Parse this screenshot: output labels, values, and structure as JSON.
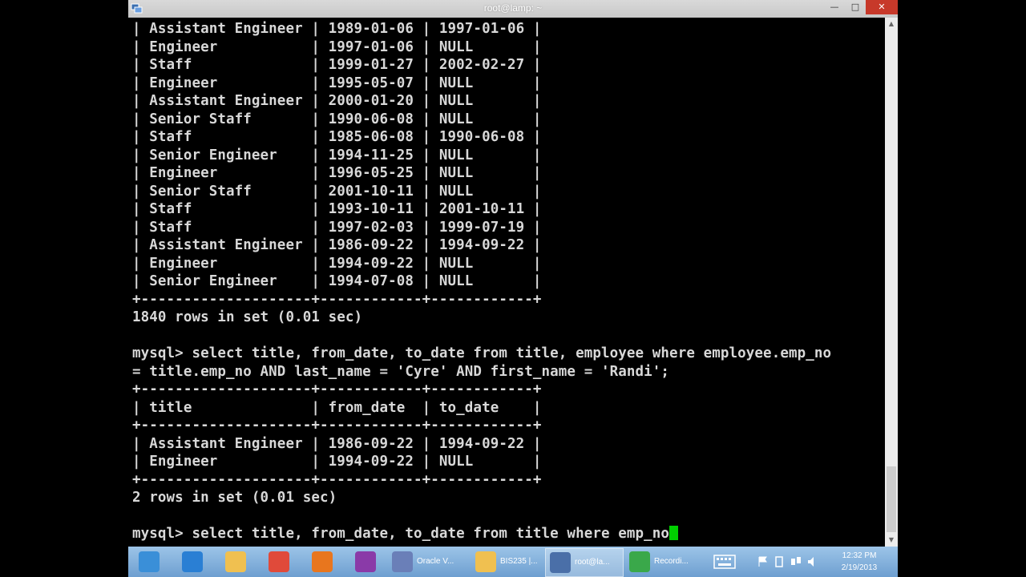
{
  "window": {
    "title": "root@lamp: ~"
  },
  "terminal": {
    "lines": [
      "| Assistant Engineer | 1989-01-06 | 1997-01-06 |",
      "| Engineer           | 1997-01-06 | NULL       |",
      "| Staff              | 1999-01-27 | 2002-02-27 |",
      "| Engineer           | 1995-05-07 | NULL       |",
      "| Assistant Engineer | 2000-01-20 | NULL       |",
      "| Senior Staff       | 1990-06-08 | NULL       |",
      "| Staff              | 1985-06-08 | 1990-06-08 |",
      "| Senior Engineer    | 1994-11-25 | NULL       |",
      "| Engineer           | 1996-05-25 | NULL       |",
      "| Senior Staff       | 2001-10-11 | NULL       |",
      "| Staff              | 1993-10-11 | 2001-10-11 |",
      "| Staff              | 1997-02-03 | 1999-07-19 |",
      "| Assistant Engineer | 1986-09-22 | 1994-09-22 |",
      "| Engineer           | 1994-09-22 | NULL       |",
      "| Senior Engineer    | 1994-07-08 | NULL       |",
      "+--------------------+------------+------------+",
      "1840 rows in set (0.01 sec)",
      "",
      "mysql> select title, from_date, to_date from title, employee where employee.emp_no",
      "= title.emp_no AND last_name = 'Cyre' AND first_name = 'Randi';",
      "+--------------------+------------+------------+",
      "| title              | from_date  | to_date    |",
      "+--------------------+------------+------------+",
      "| Assistant Engineer | 1986-09-22 | 1994-09-22 |",
      "| Engineer           | 1994-09-22 | NULL       |",
      "+--------------------+------------+------------+",
      "2 rows in set (0.01 sec)",
      ""
    ],
    "prompt_line": "mysql> select title, from_date, to_date from title where emp_no"
  },
  "taskbar": {
    "items": [
      {
        "icon": "windows-start-icon",
        "label": "",
        "color": "#3a8fd8"
      },
      {
        "icon": "internet-explorer-icon",
        "label": "",
        "color": "#2a7fd4"
      },
      {
        "icon": "file-explorer-icon",
        "label": "",
        "color": "#f0c050"
      },
      {
        "icon": "chrome-icon",
        "label": "",
        "color": "#e04a3a"
      },
      {
        "icon": "firefox-icon",
        "label": "",
        "color": "#e8761e"
      },
      {
        "icon": "onenote-icon",
        "label": "",
        "color": "#8a3aa8"
      },
      {
        "icon": "virtualbox-icon",
        "label": "Oracle V...",
        "color": "#6a7fb8"
      },
      {
        "icon": "folder-icon",
        "label": "BIS235 |...",
        "color": "#f0c050"
      },
      {
        "icon": "putty-icon",
        "label": "root@la...",
        "color": "#4a6fa8"
      },
      {
        "icon": "recording-icon",
        "label": "Recordi...",
        "color": "#3aa84a"
      }
    ],
    "clock_time": "12:32 PM",
    "clock_date": "2/19/2013"
  },
  "colors": {
    "terminal_text": "#d8d8d8",
    "cursor": "#00d000",
    "close_button": "#c7392a"
  }
}
